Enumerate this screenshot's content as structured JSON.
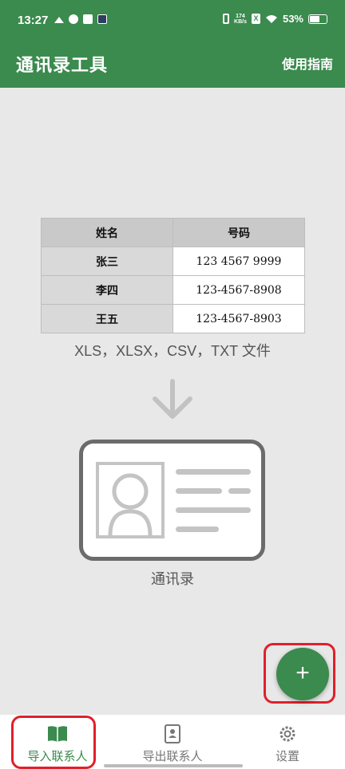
{
  "status_bar": {
    "time": "13:27",
    "net_speed_top": "174",
    "net_speed_unit": "KB/s",
    "sim_label": "X",
    "battery": "53%"
  },
  "header": {
    "title": "通讯录工具",
    "guide_link": "使用指南"
  },
  "sample_table": {
    "headers": [
      "姓名",
      "号码"
    ],
    "rows": [
      {
        "name": "张三",
        "phone": "123 4567 9999"
      },
      {
        "name": "李四",
        "phone": "123-4567-8908"
      },
      {
        "name": "王五",
        "phone": "123-4567-8903"
      }
    ]
  },
  "formats_caption": "XLS，XLSX，CSV，TXT 文件",
  "contacts_caption": "通讯录",
  "fab": {
    "label": "+"
  },
  "bottom_nav": {
    "items": [
      {
        "label": "导入联系人",
        "icon": "book-open-icon",
        "active": true
      },
      {
        "label": "导出联系人",
        "icon": "contact-book-icon",
        "active": false
      },
      {
        "label": "设置",
        "icon": "gear-icon",
        "active": false
      }
    ]
  },
  "colors": {
    "primary": "#3b8a4e",
    "highlight": "#e0202a",
    "background": "#e8e8e8"
  }
}
